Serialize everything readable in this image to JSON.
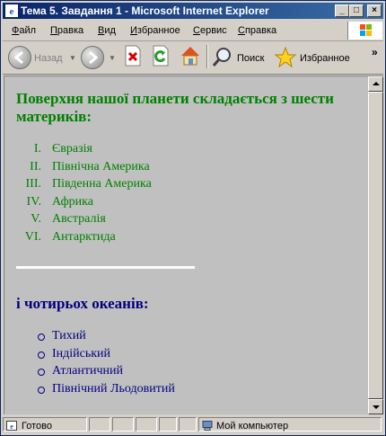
{
  "window": {
    "title": "Тема 5. Завдання 1 - Microsoft Internet Explorer",
    "controls": {
      "minimize": "_",
      "maximize": "□",
      "close": "×"
    }
  },
  "menu": [
    {
      "accel": "Ф",
      "rest": "айл"
    },
    {
      "accel": "П",
      "rest": "равка"
    },
    {
      "accel": "В",
      "rest": "ид"
    },
    {
      "accel": "И",
      "rest": "збранное"
    },
    {
      "accel": "С",
      "rest": "ервис"
    },
    {
      "accel": "С",
      "rest": "правка"
    }
  ],
  "toolbar": {
    "back_label": "Назад",
    "search_label": "Поиск",
    "favorites_label": "Избранное",
    "more": "»"
  },
  "content": {
    "continents_heading": "Поверхня нашої планети складається з шести материків:",
    "continents": [
      {
        "num": "I.",
        "name": "Євразія"
      },
      {
        "num": "II.",
        "name": "Північна Америка"
      },
      {
        "num": "III.",
        "name": "Південна Америка"
      },
      {
        "num": "IV.",
        "name": "Африка"
      },
      {
        "num": "V.",
        "name": "Австралія"
      },
      {
        "num": "VI.",
        "name": "Антарктида"
      }
    ],
    "oceans_heading": "і чотирьох океанів:",
    "oceans": [
      "Тихий",
      "Індійський",
      "Атлантичний",
      "Північний Льодовитий"
    ],
    "colors": {
      "continents": "#008000",
      "oceans": "#000080",
      "background": "#c0c0c0",
      "rule": "#ffffff"
    }
  },
  "statusbar": {
    "status_text": "Готово",
    "zone_text": "Мой компьютер"
  }
}
